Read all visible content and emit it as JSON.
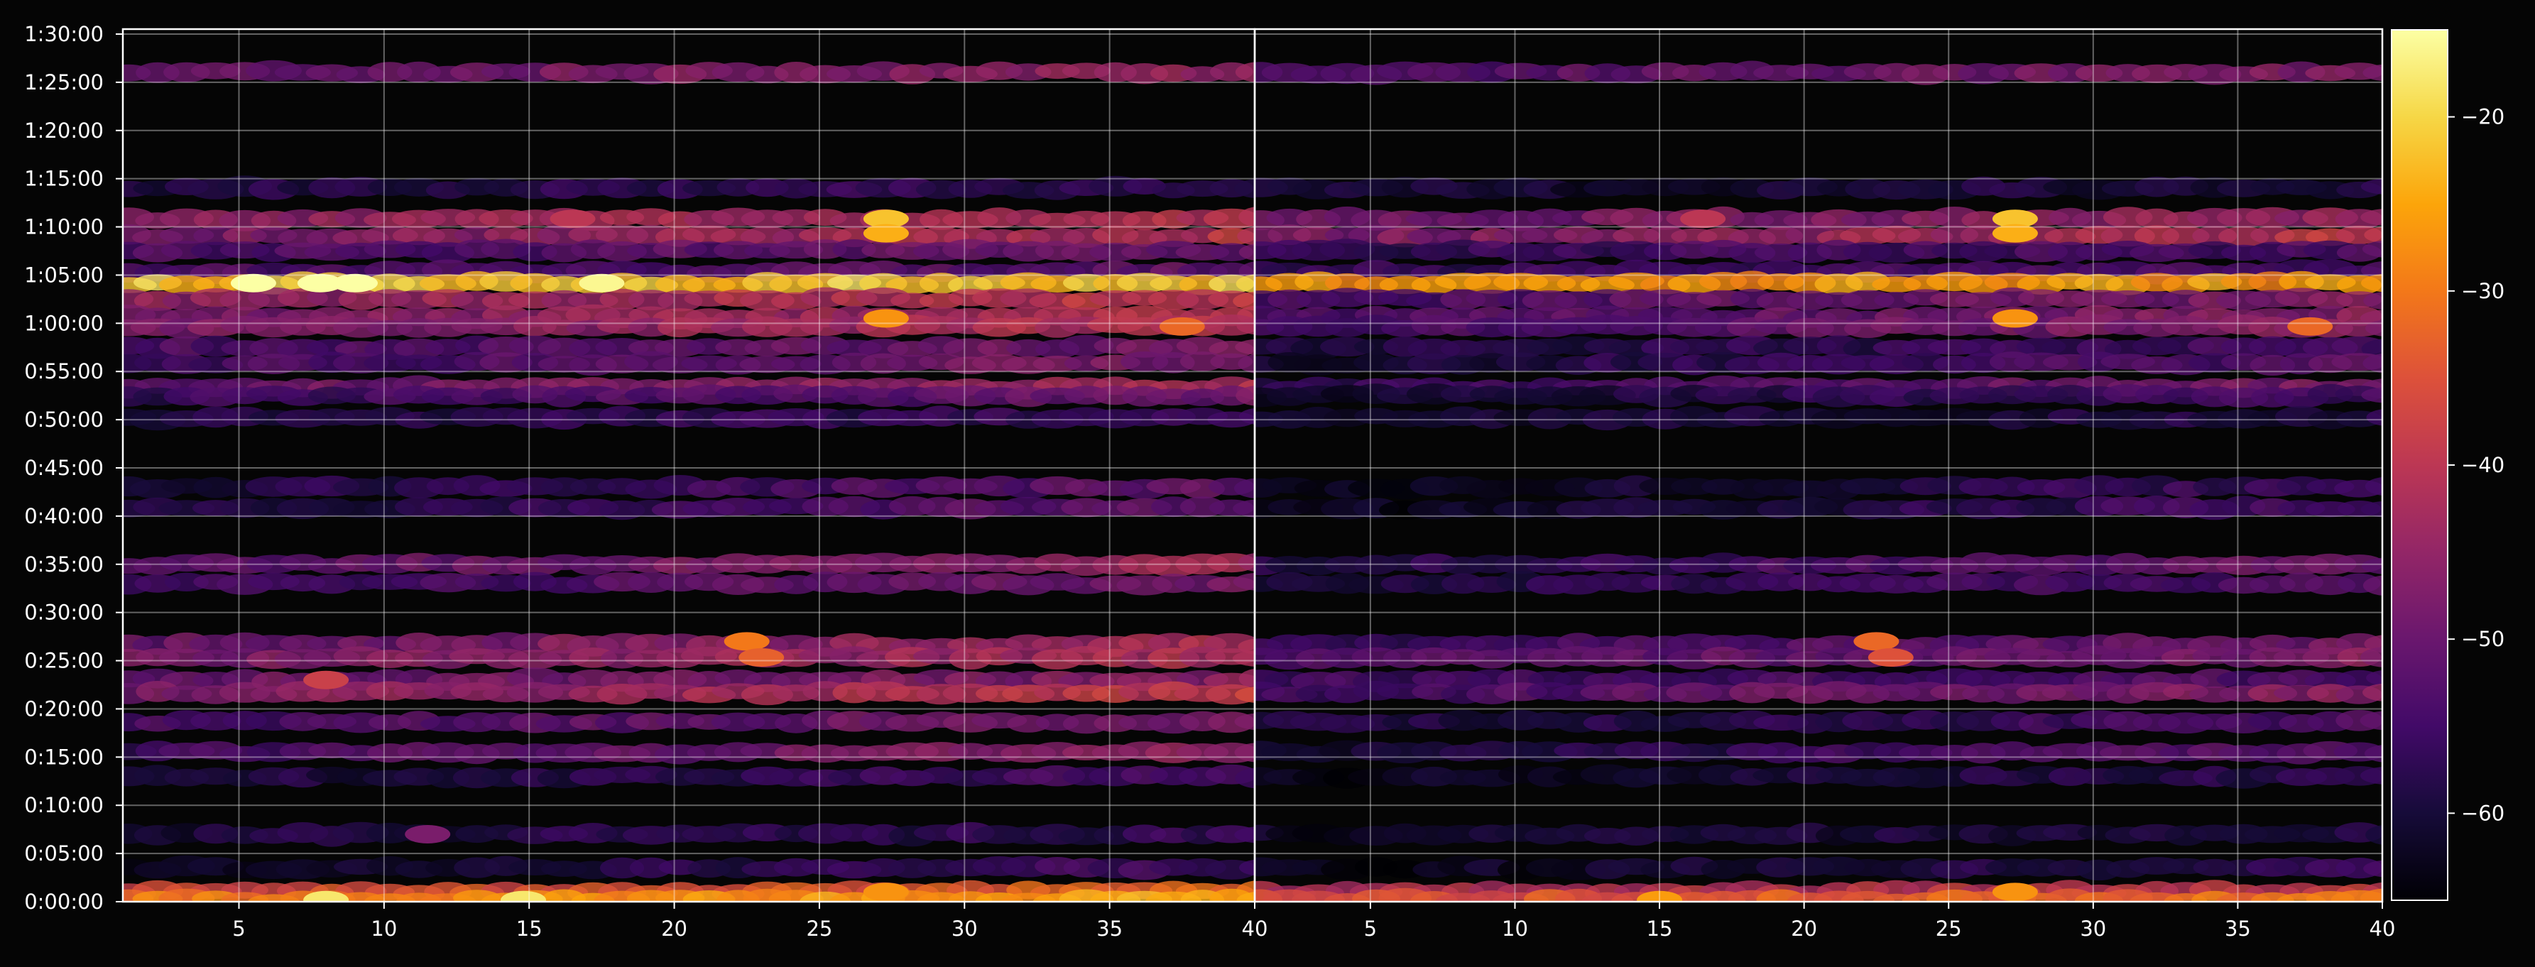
{
  "chart_data": {
    "type": "heatmap",
    "title": "",
    "xlabel": "",
    "ylabel": "",
    "background": "#050505",
    "colormap": "inferno",
    "grid": true,
    "panels": [
      {
        "name": "left",
        "xlim": [
          1,
          40
        ],
        "xticks": [
          "5",
          "10",
          "15",
          "20",
          "25",
          "30",
          "35",
          "40"
        ],
        "xtick_values": [
          5,
          10,
          15,
          20,
          25,
          30,
          35,
          40
        ]
      },
      {
        "name": "right",
        "xlim": [
          1,
          40
        ],
        "xticks": [
          "5",
          "10",
          "15",
          "20",
          "25",
          "30",
          "35",
          "40"
        ],
        "xtick_values": [
          5,
          10,
          15,
          20,
          25,
          30,
          35,
          40
        ]
      }
    ],
    "y_range_seconds": [
      0,
      5400
    ],
    "yticks": [
      "0:00:00",
      "0:05:00",
      "0:10:00",
      "0:15:00",
      "0:20:00",
      "0:25:00",
      "0:30:00",
      "0:35:00",
      "0:40:00",
      "0:45:00",
      "0:50:00",
      "0:55:00",
      "1:00:00",
      "1:05:00",
      "1:10:00",
      "1:15:00",
      "1:20:00",
      "1:25:00",
      "1:30:00"
    ],
    "colorbar": {
      "range": [
        -65,
        -15
      ],
      "ticks": [
        "−20",
        "−30",
        "−40",
        "−50",
        "−60"
      ],
      "tick_values": [
        -20,
        -30,
        -40,
        -50,
        -60
      ]
    },
    "bands": [
      {
        "t": 5160,
        "left": -47,
        "right": -50,
        "slope": 0.4
      },
      {
        "t": 4440,
        "left": -57,
        "right": -60,
        "slope": 0.1
      },
      {
        "t": 4250,
        "left": -43,
        "right": -47,
        "slope": 0.3
      },
      {
        "t": 4140,
        "left": -44,
        "right": -44,
        "slope": 0.5
      },
      {
        "t": 4050,
        "left": -52,
        "right": -55,
        "slope": 0.2
      },
      {
        "t": 3920,
        "left": -52,
        "right": -55,
        "slope": 0.2
      },
      {
        "t": 3850,
        "left": -21,
        "right": -26,
        "slope": 0.0
      },
      {
        "t": 3750,
        "left": -42,
        "right": -50,
        "slope": 0.4
      },
      {
        "t": 3640,
        "left": -44,
        "right": -50,
        "slope": 0.5
      },
      {
        "t": 3580,
        "left": -44,
        "right": -50,
        "slope": 0.5
      },
      {
        "t": 3450,
        "left": -51,
        "right": -57,
        "slope": 0.3
      },
      {
        "t": 3350,
        "left": -51,
        "right": -56,
        "slope": 0.5
      },
      {
        "t": 3200,
        "left": -46,
        "right": -52,
        "slope": 0.6
      },
      {
        "t": 3150,
        "left": -53,
        "right": -58,
        "slope": 0.4
      },
      {
        "t": 3010,
        "left": -57,
        "right": -60,
        "slope": 0.2
      },
      {
        "t": 2580,
        "left": -55,
        "right": -59,
        "slope": 0.5
      },
      {
        "t": 2450,
        "left": -55,
        "right": -59,
        "slope": 0.6
      },
      {
        "t": 2100,
        "left": -48,
        "right": -54,
        "slope": 0.5
      },
      {
        "t": 1980,
        "left": -52,
        "right": -56,
        "slope": 0.5
      },
      {
        "t": 1600,
        "left": -46,
        "right": -52,
        "slope": 0.5
      },
      {
        "t": 1520,
        "left": -45,
        "right": -50,
        "slope": 0.4
      },
      {
        "t": 1380,
        "left": -48,
        "right": -54,
        "slope": 0.2
      },
      {
        "t": 1300,
        "left": -43,
        "right": -50,
        "slope": 0.6
      },
      {
        "t": 1120,
        "left": -51,
        "right": -57,
        "slope": 0.4
      },
      {
        "t": 930,
        "left": -50,
        "right": -56,
        "slope": 0.6
      },
      {
        "t": 780,
        "left": -57,
        "right": -60,
        "slope": 0.4
      },
      {
        "t": 420,
        "left": -58,
        "right": -60,
        "slope": 0.2
      },
      {
        "t": 210,
        "left": -58,
        "right": -60,
        "slope": 0.4
      },
      {
        "t": 60,
        "left": -34,
        "right": -40,
        "slope": 0.2
      },
      {
        "t": 10,
        "left": -27,
        "right": -33,
        "slope": 0.3
      }
    ],
    "hotspots": [
      {
        "panel": "left",
        "x": 27.3,
        "t": 4250,
        "value": -22
      },
      {
        "panel": "left",
        "x": 27.3,
        "t": 4160,
        "value": -24
      },
      {
        "panel": "left",
        "x": 16.5,
        "t": 4250,
        "value": -40
      },
      {
        "panel": "left",
        "x": 7.8,
        "t": 3850,
        "value": -15
      },
      {
        "panel": "left",
        "x": 5.5,
        "t": 3850,
        "value": -15
      },
      {
        "panel": "left",
        "x": 9.0,
        "t": 3850,
        "value": -15
      },
      {
        "panel": "left",
        "x": 17.5,
        "t": 3850,
        "value": -16
      },
      {
        "panel": "left",
        "x": 27.3,
        "t": 3630,
        "value": -27
      },
      {
        "panel": "left",
        "x": 37.5,
        "t": 3580,
        "value": -32
      },
      {
        "panel": "left",
        "x": 22.5,
        "t": 1620,
        "value": -30
      },
      {
        "panel": "left",
        "x": 23.0,
        "t": 1520,
        "value": -33
      },
      {
        "panel": "left",
        "x": 8.0,
        "t": 1380,
        "value": -38
      },
      {
        "panel": "left",
        "x": 11.5,
        "t": 420,
        "value": -48
      },
      {
        "panel": "left",
        "x": 8.0,
        "t": 10,
        "value": -18
      },
      {
        "panel": "left",
        "x": 14.8,
        "t": 10,
        "value": -18
      },
      {
        "panel": "left",
        "x": 27.3,
        "t": 60,
        "value": -27
      },
      {
        "panel": "right",
        "x": 27.3,
        "t": 4250,
        "value": -22
      },
      {
        "panel": "right",
        "x": 27.3,
        "t": 4160,
        "value": -24
      },
      {
        "panel": "right",
        "x": 16.5,
        "t": 4250,
        "value": -40
      },
      {
        "panel": "right",
        "x": 27.3,
        "t": 3630,
        "value": -27
      },
      {
        "panel": "right",
        "x": 37.5,
        "t": 3580,
        "value": -32
      },
      {
        "panel": "right",
        "x": 22.5,
        "t": 1620,
        "value": -32
      },
      {
        "panel": "right",
        "x": 23.0,
        "t": 1520,
        "value": -35
      },
      {
        "panel": "right",
        "x": 27.3,
        "t": 60,
        "value": -27
      },
      {
        "panel": "right",
        "x": 15.0,
        "t": 10,
        "value": -26
      }
    ]
  }
}
